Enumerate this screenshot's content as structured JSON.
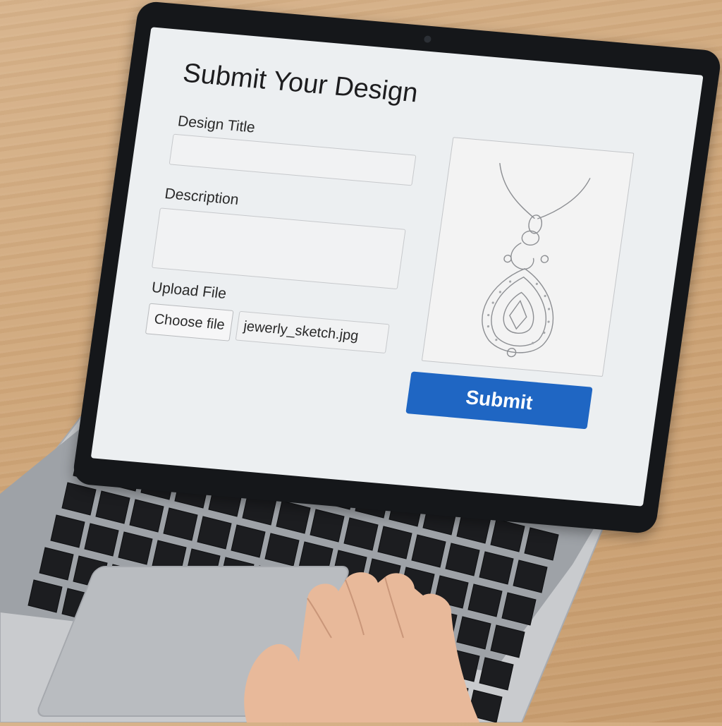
{
  "form": {
    "title": "Submit Your Design",
    "design_title_label": "Design Title",
    "design_title_value": "",
    "description_label": "Description",
    "description_value": "",
    "upload_label": "Upload File",
    "choose_file_label": "Choose file",
    "file_name": "jewerly_sketch.jpg",
    "submit_label": "Submit"
  },
  "preview": {
    "icon": "pendant-sketch-image"
  },
  "colors": {
    "submit_button": "#1f66c3",
    "screen_bg": "#eceff1"
  }
}
